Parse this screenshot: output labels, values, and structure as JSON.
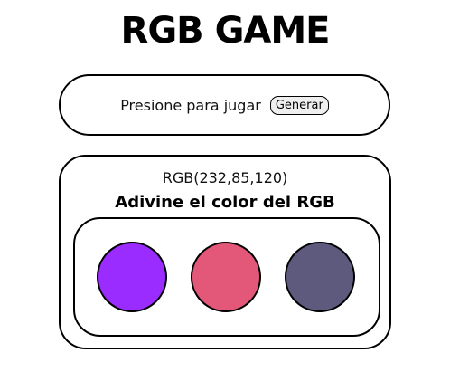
{
  "title": "RGB GAME",
  "play": {
    "prompt": "Presione para jugar",
    "button_label": "Generar"
  },
  "game": {
    "rgb_code": "RGB(232,85,120)",
    "instruction": "Adivine el color del RGB",
    "options": [
      {
        "color": "#9a2cff"
      },
      {
        "color": "#e35879"
      },
      {
        "color": "#5d5a7e"
      }
    ]
  }
}
